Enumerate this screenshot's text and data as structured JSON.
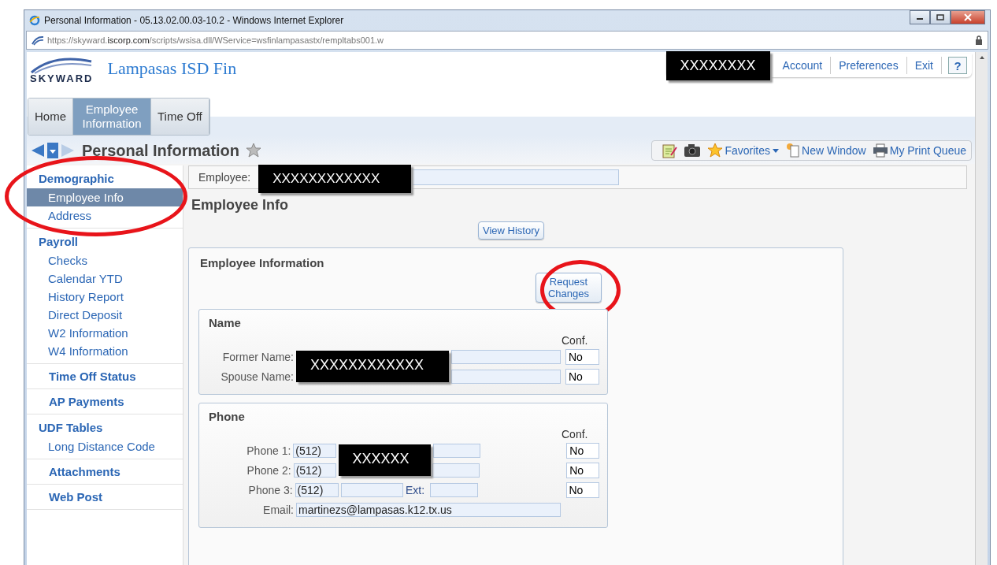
{
  "window": {
    "title": "Personal Information - 05.13.02.00.03-10.2 - Windows Internet Explorer",
    "url": "https://skyward.**iscorp.com**/scripts/wsisa.dll/WService=wsfinlampasastx/rempltabs001.w"
  },
  "header": {
    "logo": "SKYWARD",
    "site_name": "Lampasas ISD Fin",
    "user_redaction": "XXXXXXXX",
    "links": [
      "Account",
      "Preferences",
      "Exit"
    ],
    "help": "?"
  },
  "tabs": [
    {
      "label": "Home",
      "selected": false
    },
    {
      "label": "Employee Information",
      "selected": true
    },
    {
      "label": "Time Off",
      "selected": false
    }
  ],
  "page_title": "Personal Information",
  "toolbar": {
    "favorites": "Favorites",
    "new_window": "New Window",
    "print_queue": "My Print Queue"
  },
  "sidebar": [
    {
      "kind": "group",
      "label": "Demographic",
      "items": [
        {
          "label": "Employee Info",
          "selected": true
        },
        {
          "label": "Address",
          "selected": false
        }
      ]
    },
    {
      "kind": "group",
      "label": "Payroll",
      "items": [
        {
          "label": "Checks",
          "selected": false
        },
        {
          "label": "Calendar YTD",
          "selected": false
        },
        {
          "label": "History Report",
          "selected": false
        },
        {
          "label": "Direct Deposit",
          "selected": false
        },
        {
          "label": "W2 Information",
          "selected": false
        },
        {
          "label": "W4 Information",
          "selected": false
        }
      ]
    },
    {
      "kind": "link",
      "label": "Time Off Status"
    },
    {
      "kind": "link",
      "label": "AP Payments"
    },
    {
      "kind": "group",
      "label": "UDF Tables",
      "items": [
        {
          "label": "Long Distance Code",
          "selected": false
        }
      ]
    },
    {
      "kind": "link",
      "label": "Attachments"
    },
    {
      "kind": "link",
      "label": "Web Post"
    }
  ],
  "employee": {
    "label": "Employee:",
    "redaction": "XXXXXXXXXXXX"
  },
  "section_title": "Employee Info",
  "view_history": "View History",
  "panel": {
    "title": "Employee Information",
    "request_changes": "Request Changes",
    "name": {
      "title": "Name",
      "conf_header": "Conf.",
      "redaction": "XXXXXXXXXXXX",
      "rows": [
        {
          "label": "Former Name:",
          "conf": "No"
        },
        {
          "label": "Spouse Name:",
          "conf": "No"
        }
      ]
    },
    "phone": {
      "title": "Phone",
      "conf_header": "Conf.",
      "redaction": "XXXXXX",
      "rows": [
        {
          "label": "Phone 1:",
          "area": "(512)",
          "conf": "No"
        },
        {
          "label": "Phone 2:",
          "area": "(512)",
          "conf": "No"
        },
        {
          "label": "Phone 3:",
          "area": "(512)",
          "ext_label": "Ext:",
          "conf": "No"
        }
      ],
      "email_label": "Email:",
      "email": "martinezs@lampasas.k12.tx.us"
    }
  }
}
